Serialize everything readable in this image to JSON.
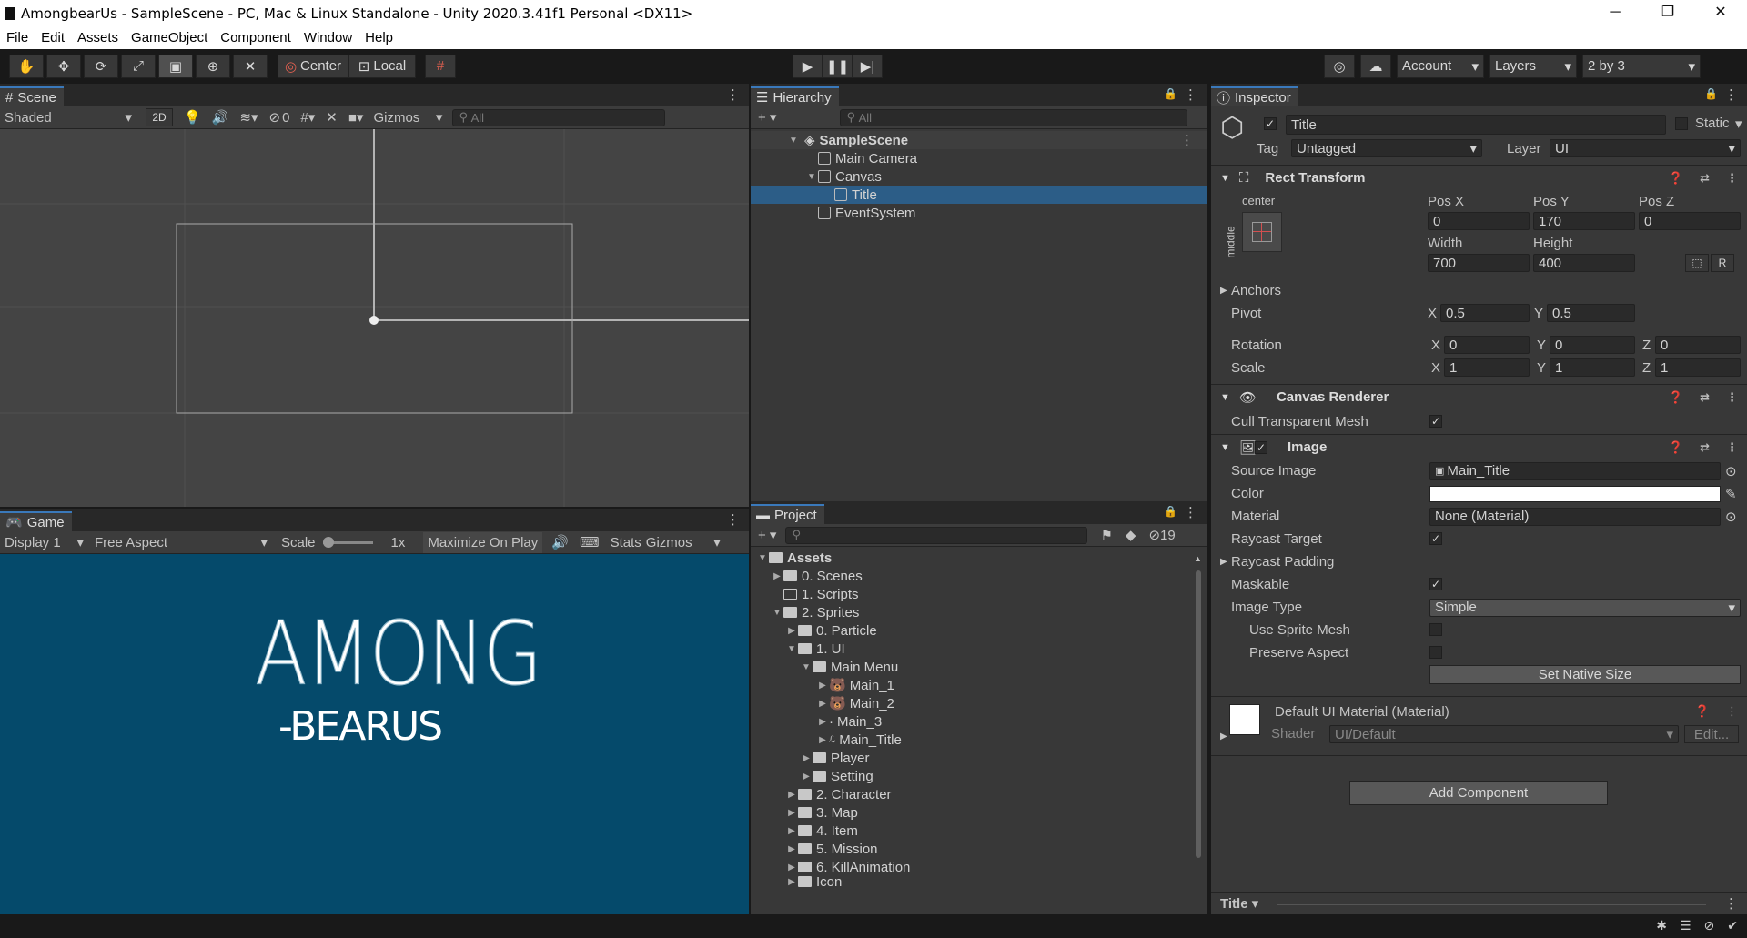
{
  "window": {
    "title": "AmongbearUs - SampleScene - PC, Mac & Linux Standalone - Unity 2020.3.41f1 Personal <DX11>",
    "minimize": "─",
    "restore": "❐",
    "close": "✕"
  },
  "menu": [
    "File",
    "Edit",
    "Assets",
    "GameObject",
    "Component",
    "Window",
    "Help"
  ],
  "toolbar": {
    "pivot": "Center",
    "space": "Local",
    "account": "Account",
    "layers": "Layers",
    "layout": "2 by 3"
  },
  "scene": {
    "tab": "Scene",
    "shading": "Shaded",
    "mode2d": "2D",
    "hidden_count": "0",
    "gizmos": "Gizmos",
    "search_placeholder": "All"
  },
  "game": {
    "tab": "Game",
    "display": "Display 1",
    "aspect": "Free Aspect",
    "scale_label": "Scale",
    "scale_value": "1x",
    "maximize": "Maximize On Play",
    "stats": "Stats",
    "gizmos": "Gizmos",
    "logo_line1": "AMONG",
    "logo_line2": "-BEARUS",
    "bg_color": "#054a6b"
  },
  "hierarchy": {
    "tab": "Hierarchy",
    "search_placeholder": "All",
    "items": [
      {
        "label": "SampleScene",
        "depth": 0,
        "type": "scene"
      },
      {
        "label": "Main Camera",
        "depth": 1,
        "type": "obj"
      },
      {
        "label": "Canvas",
        "depth": 1,
        "type": "obj"
      },
      {
        "label": "Title",
        "depth": 2,
        "type": "obj"
      },
      {
        "label": "EventSystem",
        "depth": 1,
        "type": "obj"
      }
    ]
  },
  "project": {
    "tab": "Project",
    "count": "19",
    "items": [
      {
        "label": "Assets",
        "depth": 0
      },
      {
        "label": "0. Scenes",
        "depth": 1
      },
      {
        "label": "1. Scripts",
        "depth": 1
      },
      {
        "label": "2. Sprites",
        "depth": 1
      },
      {
        "label": "0. Particle",
        "depth": 2
      },
      {
        "label": "1. UI",
        "depth": 2
      },
      {
        "label": "Main Menu",
        "depth": 3
      },
      {
        "label": "Main_1",
        "depth": 4
      },
      {
        "label": "Main_2",
        "depth": 4
      },
      {
        "label": "Main_3",
        "depth": 4
      },
      {
        "label": "Main_Title",
        "depth": 4
      },
      {
        "label": "Player",
        "depth": 3
      },
      {
        "label": "Setting",
        "depth": 3
      },
      {
        "label": "2. Character",
        "depth": 2
      },
      {
        "label": "3. Map",
        "depth": 2
      },
      {
        "label": "4. Item",
        "depth": 2
      },
      {
        "label": "5. Mission",
        "depth": 2
      },
      {
        "label": "6. KillAnimation",
        "depth": 2
      },
      {
        "label": "Icon",
        "depth": 2
      }
    ]
  },
  "inspector": {
    "tab": "Inspector",
    "name": "Title",
    "static": "Static",
    "tag_label": "Tag",
    "tag": "Untagged",
    "layer_label": "Layer",
    "layer": "UI",
    "rect": {
      "header": "Rect Transform",
      "anchor_h": "center",
      "anchor_v": "middle",
      "posx_label": "Pos X",
      "posy_label": "Pos Y",
      "posz_label": "Pos Z",
      "posx": "0",
      "posy": "170",
      "posz": "0",
      "width_label": "Width",
      "height_label": "Height",
      "width": "700",
      "height": "400",
      "r_btn": "R",
      "anchors": "Anchors",
      "pivot": "Pivot",
      "pivot_x": "0.5",
      "pivot_y": "0.5",
      "rotation": "Rotation",
      "rot_x": "0",
      "rot_y": "0",
      "rot_z": "0",
      "scale": "Scale",
      "sc_x": "1",
      "sc_y": "1",
      "sc_z": "1",
      "x": "X",
      "y": "Y",
      "z": "Z"
    },
    "canvas_renderer": {
      "header": "Canvas Renderer",
      "cull": "Cull Transparent Mesh"
    },
    "image": {
      "header": "Image",
      "source_label": "Source Image",
      "source": "Main_Title",
      "color_label": "Color",
      "material_label": "Material",
      "material": "None (Material)",
      "raycast_target": "Raycast Target",
      "raycast_padding": "Raycast Padding",
      "maskable": "Maskable",
      "image_type_label": "Image Type",
      "image_type": "Simple",
      "use_sprite_mesh": "Use Sprite Mesh",
      "preserve_aspect": "Preserve Aspect",
      "native_size": "Set Native Size"
    },
    "material": {
      "name": "Default UI Material (Material)",
      "shader_label": "Shader",
      "shader": "UI/Default",
      "edit": "Edit..."
    },
    "add_component": "Add Component",
    "footer": "Title"
  }
}
